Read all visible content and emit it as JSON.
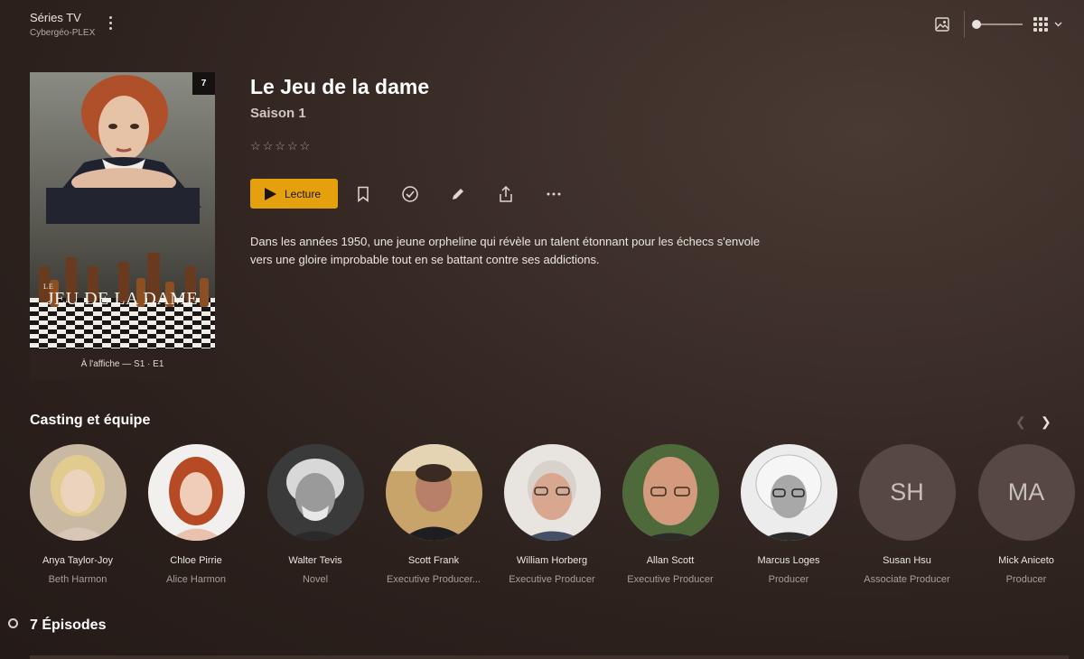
{
  "header": {
    "library_title": "Séries TV",
    "server_name": "Cybergéo-PLEX",
    "icons": [
      "more-vertical-icon",
      "image-icon",
      "grid-icon",
      "chevron-down-icon"
    ]
  },
  "poster": {
    "badge": "7",
    "art_title_small": "LE",
    "art_title": "JEU DE LA DAME",
    "caption": "À l'affiche — S1 · E1"
  },
  "show": {
    "title": "Le Jeu de la dame",
    "season": "Saison 1",
    "rating_stars": "☆☆☆☆☆",
    "play_label": "Lecture",
    "summary": "Dans les années 1950, une jeune orpheline qui révèle un talent étonnant pour les échecs s'envole vers une gloire improbable tout en se battant contre ses addictions.",
    "accent_color": "#e5a00d"
  },
  "cast": {
    "title": "Casting et équipe",
    "members": [
      {
        "name": "Anya Taylor-Joy",
        "role": "Beth Harmon"
      },
      {
        "name": "Chloe Pirrie",
        "role": "Alice Harmon"
      },
      {
        "name": "Walter Tevis",
        "role": "Novel"
      },
      {
        "name": "Scott Frank",
        "role": "Executive Producer..."
      },
      {
        "name": "William Horberg",
        "role": "Executive Producer"
      },
      {
        "name": "Allan Scott",
        "role": "Executive Producer"
      },
      {
        "name": "Marcus Loges",
        "role": "Producer"
      },
      {
        "name": "Susan Hsu",
        "role": "Associate Producer",
        "initials": "SH"
      },
      {
        "name": "Mick Aniceto",
        "role": "Producer",
        "initials": "MA"
      }
    ]
  },
  "episodes": {
    "title": "7 Épisodes"
  }
}
